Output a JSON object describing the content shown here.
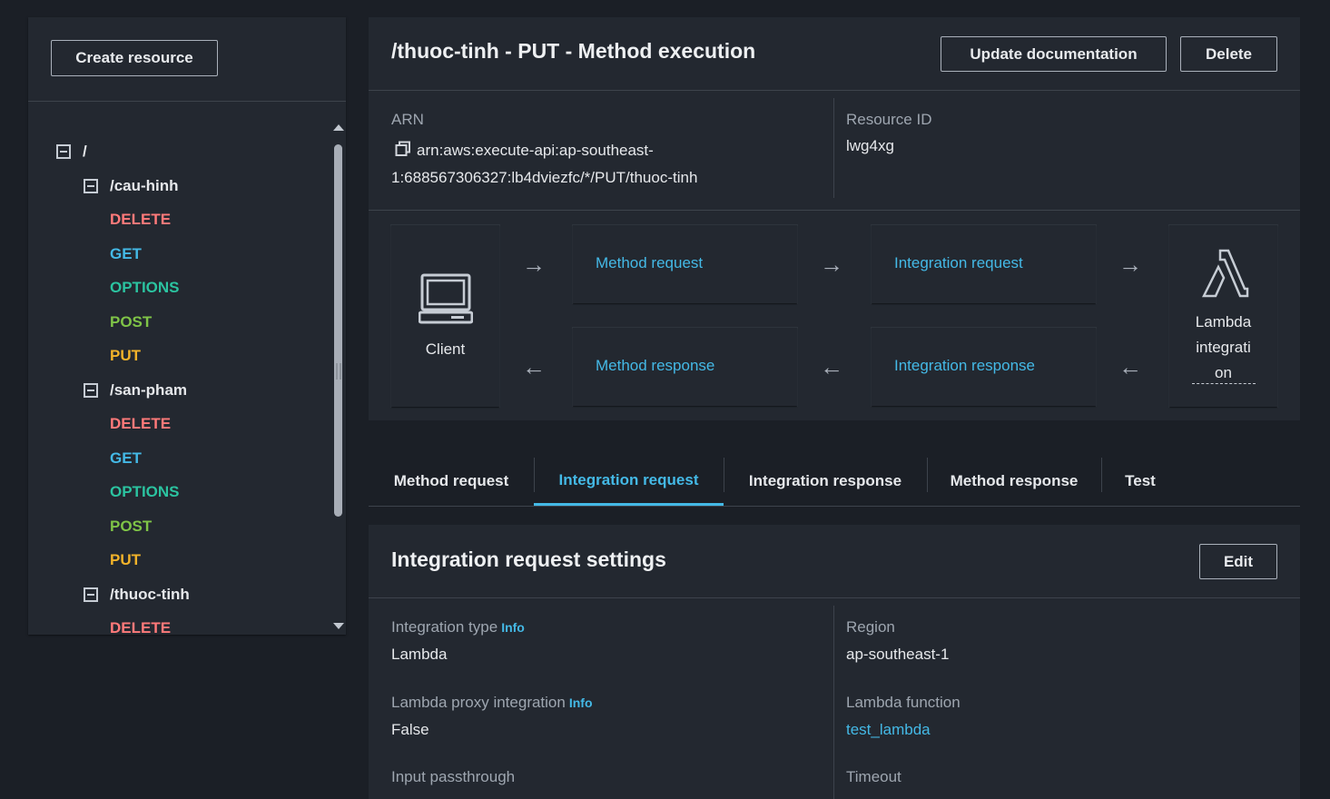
{
  "sidebar": {
    "create_button": "Create resource",
    "tree": [
      {
        "kind": "resource",
        "label": "/"
      },
      {
        "kind": "resource",
        "label": "/cau-hinh"
      },
      {
        "kind": "method",
        "label": "DELETE"
      },
      {
        "kind": "method",
        "label": "GET"
      },
      {
        "kind": "method",
        "label": "OPTIONS"
      },
      {
        "kind": "method",
        "label": "POST"
      },
      {
        "kind": "method",
        "label": "PUT"
      },
      {
        "kind": "resource",
        "label": "/san-pham"
      },
      {
        "kind": "method",
        "label": "DELETE"
      },
      {
        "kind": "method",
        "label": "GET"
      },
      {
        "kind": "method",
        "label": "OPTIONS"
      },
      {
        "kind": "method",
        "label": "POST"
      },
      {
        "kind": "method",
        "label": "PUT"
      },
      {
        "kind": "resource",
        "label": "/thuoc-tinh"
      },
      {
        "kind": "method",
        "label": "DELETE"
      }
    ]
  },
  "header": {
    "title": "/thuoc-tinh - PUT - Method execution",
    "update_doc_button": "Update documentation",
    "delete_button": "Delete"
  },
  "details": {
    "arn_label": "ARN",
    "arn_value": "arn:aws:execute-api:ap-southeast-1:688567306327:lb4dviezfc/*/PUT/thuoc-tinh",
    "arn_line1": "arn:aws:execute-api:ap-southeast-",
    "arn_line2": "1:688567306327:lb4dviezfc/*/PUT/thuoc-tinh",
    "resource_id_label": "Resource ID",
    "resource_id_value": "lwg4xg"
  },
  "flow": {
    "client": "Client",
    "method_request": "Method request",
    "integration_request": "Integration request",
    "method_response": "Method response",
    "integration_response": "Integration response",
    "lambda_line1": "Lambda",
    "lambda_line2": "integrati",
    "lambda_line3": "on"
  },
  "tabs": [
    {
      "label": "Method request",
      "active": false
    },
    {
      "label": "Integration request",
      "active": true
    },
    {
      "label": "Integration response",
      "active": false
    },
    {
      "label": "Method response",
      "active": false
    },
    {
      "label": "Test",
      "active": false
    }
  ],
  "settings": {
    "title": "Integration request settings",
    "edit_button": "Edit",
    "integration_type_label": "Integration type",
    "integration_type_info": "Info",
    "integration_type_value": "Lambda",
    "lambda_proxy_label": "Lambda proxy integration",
    "lambda_proxy_info": "Info",
    "lambda_proxy_value": "False",
    "input_passthrough_label": "Input passthrough",
    "region_label": "Region",
    "region_value": "ap-southeast-1",
    "lambda_function_label": "Lambda function",
    "lambda_function_value": "test_lambda",
    "timeout_label": "Timeout"
  },
  "colors": {
    "background": "#1b1f26",
    "panel": "#232830",
    "accent": "#44b9e6",
    "delete": "#ff7a7a",
    "get": "#44b9e6",
    "options": "#2bc3a0",
    "post": "#7fc447",
    "put": "#f2b32a"
  }
}
